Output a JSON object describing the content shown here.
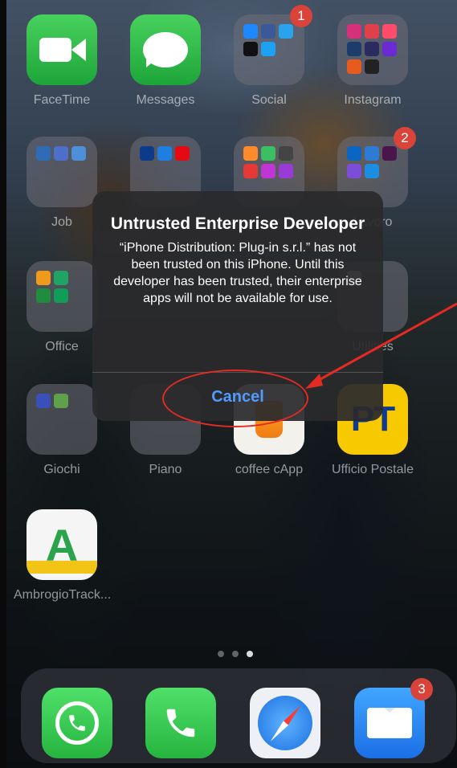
{
  "home": {
    "row1": [
      {
        "label": "FaceTime",
        "type": "app"
      },
      {
        "label": "Messages",
        "type": "app"
      },
      {
        "label": "Social",
        "type": "folder",
        "badge": "1"
      },
      {
        "label": "Instagram",
        "type": "folder"
      }
    ],
    "row2": [
      {
        "label": "Job",
        "type": "folder"
      },
      {
        "label": "",
        "type": "folder"
      },
      {
        "label": "",
        "type": "folder"
      },
      {
        "label": "Lavoro",
        "type": "folder",
        "badge": "2"
      }
    ],
    "row3": [
      {
        "label": "Office",
        "type": "folder"
      },
      {
        "label": "Utilities",
        "type": "folder"
      }
    ],
    "row4": [
      {
        "label": "Giochi",
        "type": "folder"
      },
      {
        "label": "Piano",
        "type": "folder"
      },
      {
        "label": "coffee cApp",
        "type": "app"
      },
      {
        "label": "Ufficio Postale",
        "type": "app",
        "glyph": "PT"
      }
    ],
    "row5": [
      {
        "label": "AmbrogioTrack...",
        "type": "app",
        "glyph": "A"
      }
    ]
  },
  "page_dots": {
    "count": 3,
    "active_index": 2
  },
  "dock": [
    {
      "name": "WhatsApp",
      "icon": "whatsapp-icon"
    },
    {
      "name": "Phone",
      "icon": "phone-icon"
    },
    {
      "name": "Safari",
      "icon": "safari-icon"
    },
    {
      "name": "Mail",
      "icon": "mail-icon",
      "badge": "3"
    }
  ],
  "alert": {
    "title": "Untrusted Enterprise Developer",
    "message": "“iPhone Distribution: Plug-in s.r.l.” has not been trusted on this iPhone. Until this developer has been trusted, their enterprise apps will not be available for use.",
    "cancel_label": "Cancel"
  },
  "colors": {
    "badge": "#d9433a",
    "alert_button": "#4f9bff",
    "annotation": "#e32a23"
  }
}
